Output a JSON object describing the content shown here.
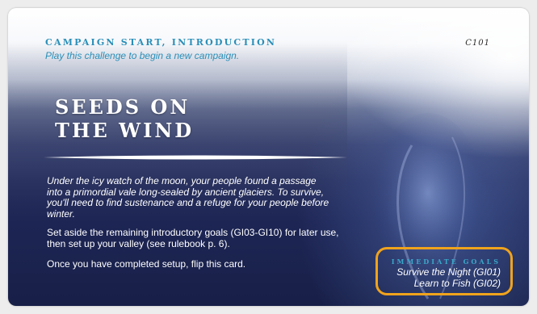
{
  "card": {
    "subheading": "Campaign Start, Introduction",
    "intro": "Play this challenge to begin a new campaign.",
    "code": "C101",
    "title_line1": "Seeds on",
    "title_line2": "the Wind",
    "flavor": "Under the icy watch of the moon, your people found a passage into a primordial vale long-sealed by ancient glaciers. To survive, you'll need to find sustenance and a refuge for your people before winter.",
    "setup": "Set aside the remaining introductory goals (GI03-GI10) for later use, then set up your valley (see rulebook p. 6).",
    "flip": "Once you have completed setup, flip this card."
  },
  "goals": {
    "heading": "Immediate Goals",
    "items": [
      "Survive the Night (GI01)",
      "Learn to Fish (GI02)"
    ]
  },
  "colors": {
    "accent_teal": "#2a8fb8",
    "highlight_orange": "#f0a31c"
  }
}
